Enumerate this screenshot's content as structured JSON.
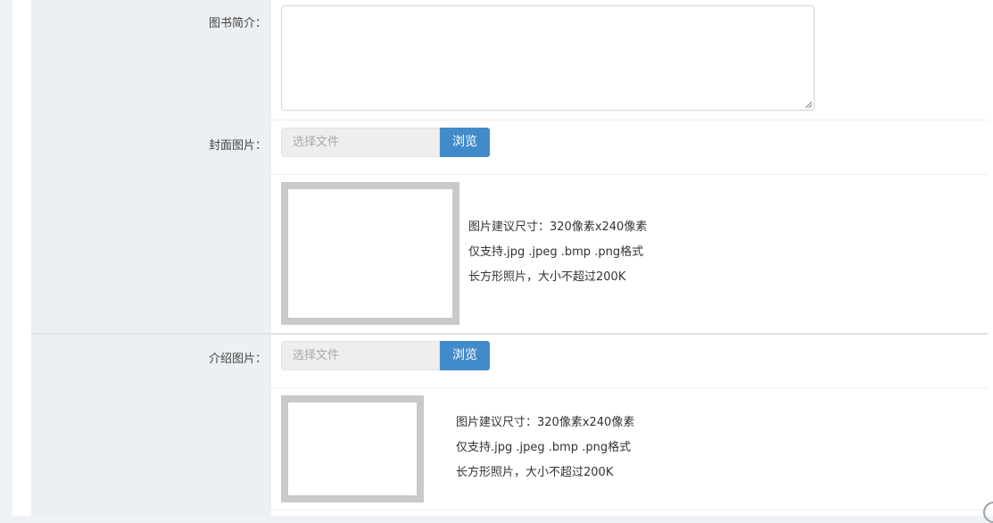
{
  "form": {
    "intro_label": "图书简介：",
    "cover": {
      "label": "封面图片：",
      "file_placeholder": "选择文件",
      "browse_label": "浏览",
      "hints": [
        "图片建议尺寸：320像素x240像素",
        "仅支持.jpg .jpeg .bmp .png格式",
        "长方形照片，大小不超过200K"
      ]
    },
    "intro_image": {
      "label": "介绍图片：",
      "file_placeholder": "选择文件",
      "browse_label": "浏览",
      "hints": [
        "图片建议尺寸：320像素x240像素",
        "仅支持.jpg .jpeg .bmp .png格式",
        "长方形照片，大小不超过200K"
      ]
    }
  },
  "colors": {
    "accent": "#428bca",
    "label_column": "#edf0f2",
    "page_background": "#eef2f6"
  }
}
